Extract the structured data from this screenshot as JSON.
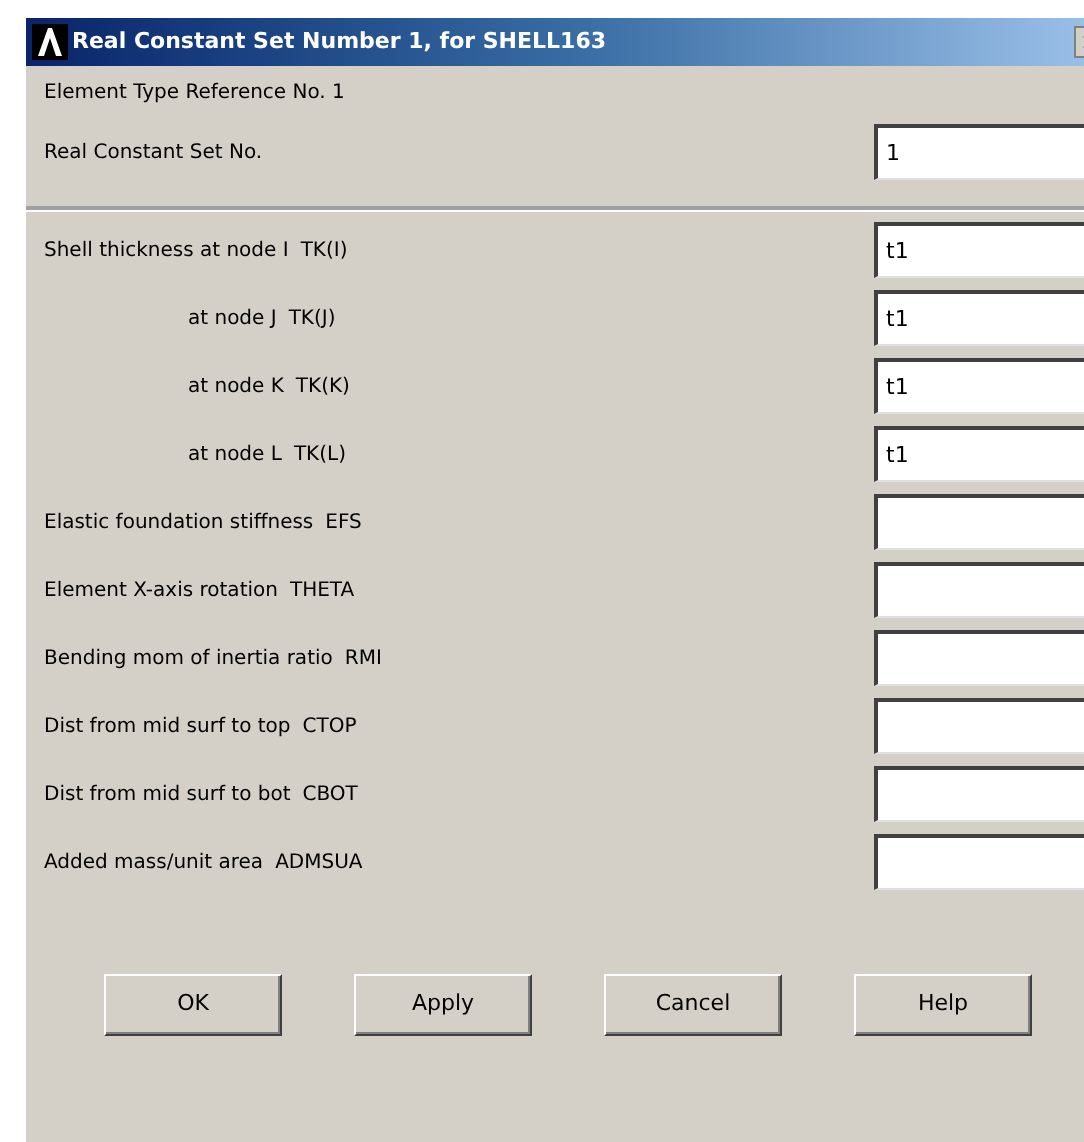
{
  "window": {
    "title": "Real Constant Set Number 1, for SHELL163"
  },
  "header": [
    {
      "label": "Element Type Reference No. 1"
    },
    {
      "label": "Real Constant Set No.",
      "value": "1"
    }
  ],
  "rows": [
    {
      "kind": "main",
      "label": "Shell thickness at node I",
      "param": "TK(I)",
      "value": "t1"
    },
    {
      "kind": "sub",
      "label": "at node J",
      "param": "TK(J)",
      "value": "t1"
    },
    {
      "kind": "sub",
      "label": "at node K",
      "param": "TK(K)",
      "value": "t1"
    },
    {
      "kind": "sub",
      "label": "at node L",
      "param": "TK(L)",
      "value": "t1"
    },
    {
      "kind": "main",
      "label": "Elastic foundation stiffness",
      "param": "EFS"
    },
    {
      "kind": "main",
      "label": "Element X-axis rotation",
      "param": "THETA"
    },
    {
      "kind": "main",
      "label": "Bending mom of inertia ratio",
      "param": "RMI"
    },
    {
      "kind": "main",
      "label": "Dist from mid surf to top",
      "param": "CTOP"
    },
    {
      "kind": "main",
      "label": "Dist from mid surf to bot",
      "param": "CBOT"
    },
    {
      "kind": "main",
      "label": "Added mass/unit area",
      "param": "ADMSUA"
    }
  ],
  "buttons": [
    "OK",
    "Apply",
    "Cancel",
    "Help"
  ]
}
